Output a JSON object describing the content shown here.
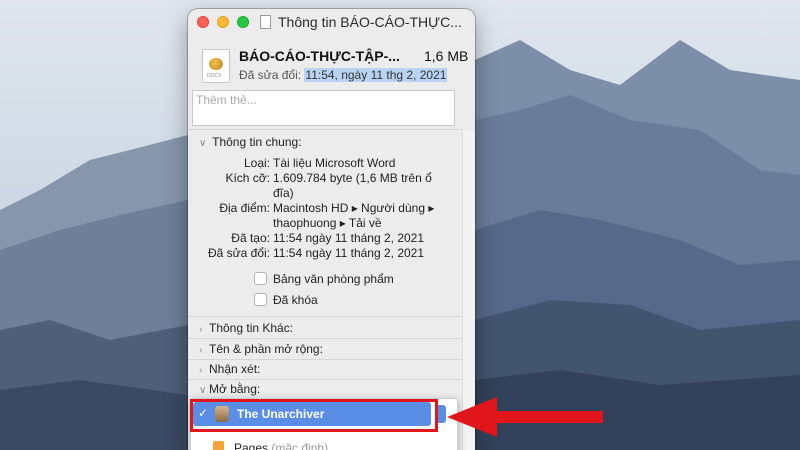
{
  "window": {
    "title": "Thông tin BÁO-CÁO-THỰC...",
    "file_name": "BÁO-CÁO-THỰC-TẬP-...",
    "file_size": "1,6 MB",
    "modified_label": "Đã sửa đổi:",
    "modified_value": "11:54, ngày 11 thg 2, 2021",
    "tags_placeholder": "Thêm thẻ..."
  },
  "general": {
    "heading": "Thông tin chung:",
    "rows": [
      {
        "label": "Loại:",
        "value": "Tài liệu Microsoft Word"
      },
      {
        "label": "Kích cỡ:",
        "value": "1.609.784 byte (1,6 MB trên ổ đĩa)"
      },
      {
        "label": "Địa điểm:",
        "value": "Macintosh HD ▸ Người dùng ▸ thaophuong ▸ Tải về"
      },
      {
        "label": "Đã tạo:",
        "value": "11:54 ngày 11 tháng 2, 2021"
      },
      {
        "label": "Đã sửa đổi:",
        "value": "11:54 ngày 11 tháng 2, 2021"
      }
    ],
    "checkboxes": [
      "Bảng văn phòng phẩm",
      "Đã khóa"
    ]
  },
  "sections": [
    "Thông tin Khác:",
    "Tên & phần mở rộng:",
    "Nhận xét:",
    "Mở bằng:"
  ],
  "open_with": {
    "selected": "The Unarchiver",
    "next_app": "Pages",
    "next_app_note": "(mặc định)"
  },
  "file_icon_text": "DOCX"
}
